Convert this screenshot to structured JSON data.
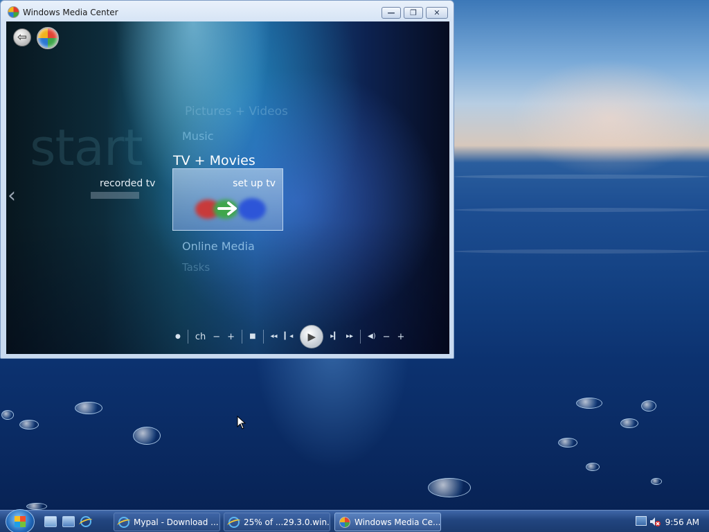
{
  "window": {
    "title": "Windows Media Center",
    "minimize_label": "—",
    "maximize_label": "❐",
    "close_label": "✕"
  },
  "media_center": {
    "back_glyph": "⇦",
    "ghost_text": "start",
    "faint_item_top": "Pictures + Videos",
    "menu_above": "Music",
    "current_category": "TV + Movies",
    "left_item": "recorded tv",
    "selected_tile": "set up tv",
    "menu_below": "Online Media",
    "faint_item_bottom": "Tasks",
    "left_arrow": "‹"
  },
  "transport": {
    "record": "●",
    "ch_label": "ch",
    "ch_down": "−",
    "ch_up": "+",
    "stop": "■",
    "rewind": "◂◂",
    "prev": "▎◂",
    "play": "▶",
    "next": "▸▎",
    "fast_forward": "▸▸",
    "volume": "◀)",
    "vol_down": "−",
    "vol_up": "+"
  },
  "taskbar": {
    "tasks": [
      {
        "label": "Mypal - Download ..."
      },
      {
        "label": "25% of ...29.3.0.win..."
      },
      {
        "label": "Windows Media Ce..."
      }
    ],
    "clock": "9:56 AM"
  }
}
